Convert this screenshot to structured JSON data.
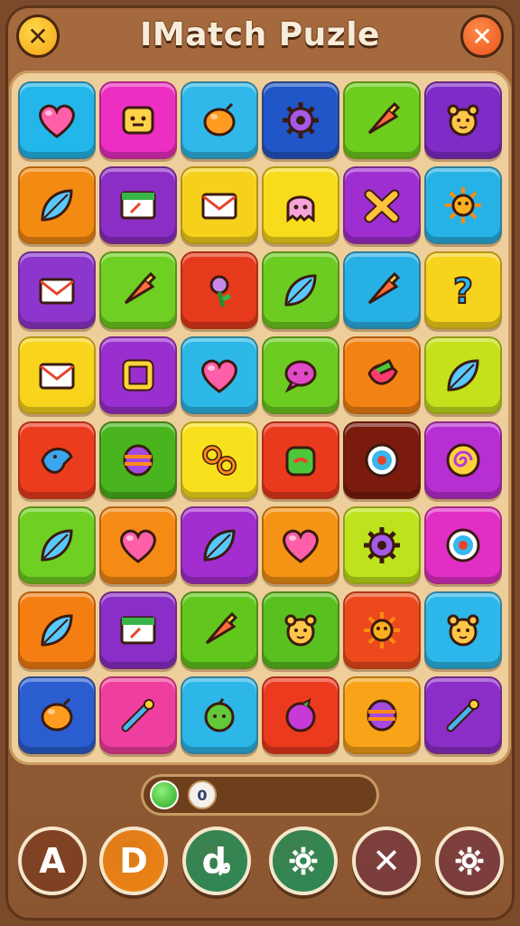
{
  "app": {
    "title": "IMatch Puzle"
  },
  "header": {
    "left_button_icon": "close-icon",
    "right_button_icon": "close-icon",
    "left_color": "#f5b81a",
    "right_color": "#ee6226"
  },
  "board": {
    "rows": [
      [
        {
          "color": "#22b6ea",
          "icon": "heart"
        },
        {
          "color": "#ec2ec2",
          "icon": "block"
        },
        {
          "color": "#2fb8e9",
          "icon": "lemon"
        },
        {
          "color": "#2056c8",
          "icon": "gear"
        },
        {
          "color": "#6ccd1d",
          "icon": "cone"
        },
        {
          "color": "#7f2bc8",
          "icon": "bear"
        }
      ],
      [
        {
          "color": "#f38a12",
          "icon": "leaf"
        },
        {
          "color": "#8b2ec6",
          "icon": "card"
        },
        {
          "color": "#f6d11b",
          "icon": "envelope"
        },
        {
          "color": "#f8dc1c",
          "icon": "ghost"
        },
        {
          "color": "#9f2ed0",
          "icon": "cross"
        },
        {
          "color": "#27b2e6",
          "icon": "sun"
        }
      ],
      [
        {
          "color": "#8d36cd",
          "icon": "envelope"
        },
        {
          "color": "#6fcf22",
          "icon": "cone"
        },
        {
          "color": "#e63a1c",
          "icon": "flower"
        },
        {
          "color": "#6dcc22",
          "icon": "leaf"
        },
        {
          "color": "#27b0e6",
          "icon": "cone"
        },
        {
          "color": "#f6d31d",
          "icon": "question"
        }
      ],
      [
        {
          "color": "#f8d51c",
          "icon": "envelope"
        },
        {
          "color": "#9a2fcf",
          "icon": "square"
        },
        {
          "color": "#2db8e8",
          "icon": "heart"
        },
        {
          "color": "#6ccc22",
          "icon": "bubble"
        },
        {
          "color": "#f28212",
          "icon": "pepper"
        },
        {
          "color": "#c4e11c",
          "icon": "leaf"
        }
      ],
      [
        {
          "color": "#ec3c1e",
          "icon": "bird"
        },
        {
          "color": "#49b41e",
          "icon": "barrel"
        },
        {
          "color": "#f8e11c",
          "icon": "rings"
        },
        {
          "color": "#ea3a1e",
          "icon": "cup"
        },
        {
          "color": "#7a1b0e",
          "icon": "target"
        },
        {
          "color": "#b72ed2",
          "icon": "spiral"
        }
      ],
      [
        {
          "color": "#6fcf22",
          "icon": "leaf"
        },
        {
          "color": "#f58a14",
          "icon": "heart"
        },
        {
          "color": "#a32ed0",
          "icon": "leaf"
        },
        {
          "color": "#f59414",
          "icon": "heart"
        },
        {
          "color": "#bde31c",
          "icon": "gear"
        },
        {
          "color": "#e12fc6",
          "icon": "target"
        }
      ],
      [
        {
          "color": "#f57e12",
          "icon": "leaf"
        },
        {
          "color": "#8a2ec8",
          "icon": "card"
        },
        {
          "color": "#61c71d",
          "icon": "cone"
        },
        {
          "color": "#58c01f",
          "icon": "bear"
        },
        {
          "color": "#ec4a1c",
          "icon": "sun"
        },
        {
          "color": "#2db7ea",
          "icon": "bear"
        }
      ],
      [
        {
          "color": "#2a5ed0",
          "icon": "lemon"
        },
        {
          "color": "#ee3f9f",
          "icon": "wand"
        },
        {
          "color": "#2db6e8",
          "icon": "fruit"
        },
        {
          "color": "#ec3a1e",
          "icon": "berry"
        },
        {
          "color": "#f8a318",
          "icon": "barrel"
        },
        {
          "color": "#8b2ec8",
          "icon": "wand"
        }
      ]
    ]
  },
  "progress": {
    "count_label": "0"
  },
  "bottom_buttons": [
    {
      "name": "a-button",
      "glyph": "A",
      "color": "#7e3f22"
    },
    {
      "name": "d-button",
      "glyph": "D",
      "color": "#f08414"
    },
    {
      "name": "accessibility-button",
      "glyph": "ȡ",
      "color": "#2a8a55"
    },
    {
      "name": "settings-button",
      "glyph": "",
      "icon": "gear",
      "color": "#2a8a55"
    },
    {
      "name": "close-button",
      "glyph": "✕",
      "color": "#7a3b3e"
    },
    {
      "name": "options-button",
      "glyph": "",
      "icon": "gear",
      "color": "#7a3b3e"
    }
  ]
}
